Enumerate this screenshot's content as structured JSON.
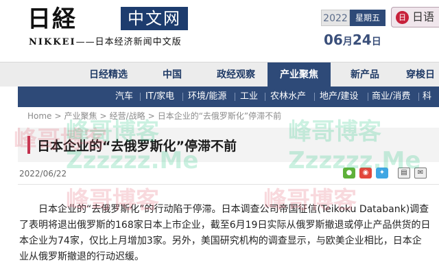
{
  "header": {
    "logo_main": "日経",
    "logo_cn": "中文网",
    "logo_sub_en": "NIKKEI",
    "logo_sub_cn": "——日本经济新闻中文版",
    "year": "2022",
    "weekday": "星期五",
    "japanese_label": "日语",
    "japanese_badge": "日",
    "month": "06",
    "month_unit": "月",
    "day_num": "24",
    "day_unit": "日"
  },
  "nav": {
    "items": [
      "日经精选",
      "中国",
      "政经观察",
      "产业聚焦",
      "新产品",
      "穿梭日"
    ]
  },
  "subnav": {
    "items": [
      "汽车",
      "IT/家电",
      "环境/能源",
      "工业",
      "农林水产",
      "地产/建设",
      "商业/消费",
      "科学"
    ]
  },
  "breadcrumb": {
    "items": [
      "Home",
      "产业聚焦",
      "经营/战略",
      "日本企业的“去俄罗斯化”停滞不前"
    ],
    "separator": ">"
  },
  "article": {
    "title": "日本企业的“去俄罗斯化”停滞不前",
    "date": "2022/06/22",
    "body": "日本企业的“去俄罗斯化”的行动陷于停滞。日本调查公司帝国征信(Teikoku Databank)调查了表明将退出俄罗斯的168家日本上市企业，截至6月19日实际从俄罗斯撤退或停止产品供货的日本企业为74家，仅比上月增加3家。另外，美国研究机构的调查显示，与欧美企业相比，日本企业从俄罗斯撤退的行动迟缓。"
  },
  "watermark": {
    "brand": "峰哥博客",
    "url": "Zzzzzz.Me"
  },
  "colors": {
    "navy": "#2e4a78",
    "accent_red": "#c2304d",
    "watermark_green": "#19c27a",
    "watermark_red": "#e2576a"
  }
}
